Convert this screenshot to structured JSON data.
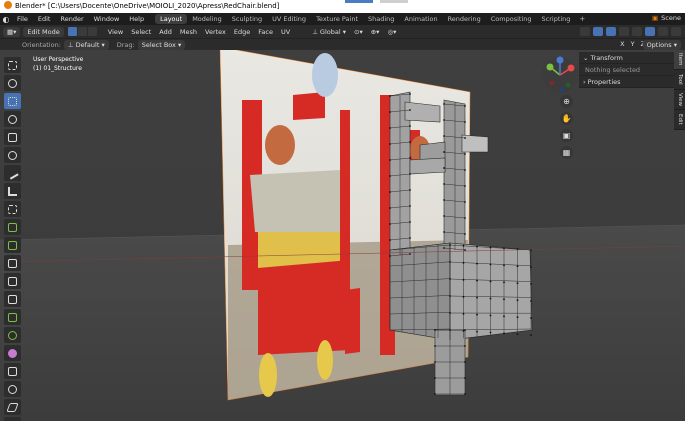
{
  "window": {
    "title": "Blender* [C:\\Users\\Docente\\OneDrive\\MOIOLI_2020\\Apress\\RedChair.blend]"
  },
  "menu": {
    "items": [
      "File",
      "Edit",
      "Render",
      "Window",
      "Help"
    ],
    "workspaces": [
      "Layout",
      "Modeling",
      "Sculpting",
      "UV Editing",
      "Texture Paint",
      "Shading",
      "Animation",
      "Rendering",
      "Compositing",
      "Scripting"
    ],
    "add_workspace": "+",
    "scene_label": "Scene"
  },
  "header": {
    "mode": "Edit Mode",
    "menus": [
      "View",
      "Select",
      "Add",
      "Mesh",
      "Vertex",
      "Edge",
      "Face",
      "UV"
    ],
    "orientation": "Global"
  },
  "tool_header": {
    "orientation_label": "Orientation:",
    "orientation_value": "Default",
    "drag_label": "Drag:",
    "drag_value": "Select Box",
    "axes": [
      "X",
      "Y",
      "Z"
    ],
    "options": "Options"
  },
  "viewport": {
    "perspective": "User Perspective",
    "object": "(1) 01_Structure"
  },
  "npanel": {
    "transform": "Transform",
    "nothing_selected": "Nothing selected",
    "properties": "Properties",
    "tabs": [
      "Item",
      "Tool",
      "View",
      "Edit"
    ]
  },
  "toolbar": {
    "tools": [
      "select-box",
      "cursor",
      "move",
      "rotate",
      "scale",
      "transform",
      "annotate",
      "measure",
      "add-cube",
      "extrude",
      "inset",
      "bevel",
      "loop-cut",
      "knife",
      "poly-build",
      "spin",
      "smooth",
      "edge-slide",
      "shrink-fatten",
      "shear",
      "rip"
    ]
  },
  "colors": {
    "accent": "#4772b3",
    "background": "#3d3d3d",
    "mesh": "#9a9a9a"
  }
}
